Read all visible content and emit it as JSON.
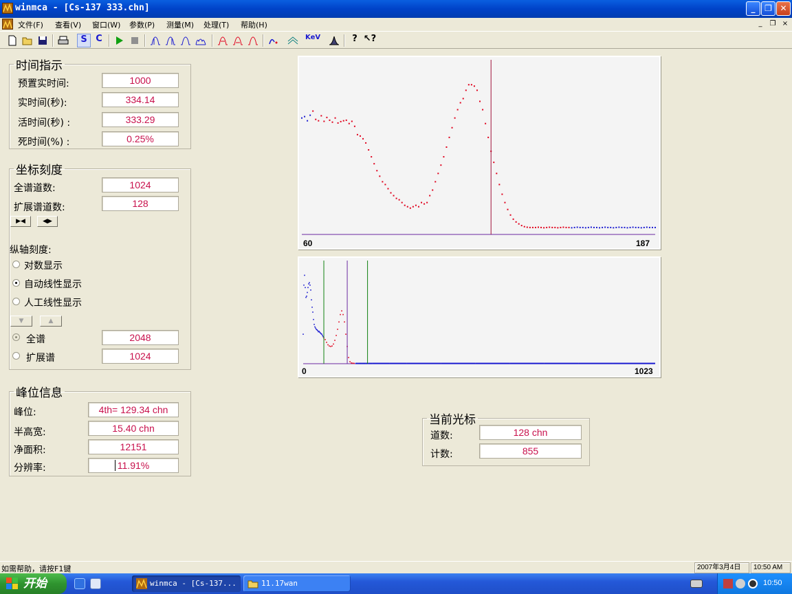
{
  "window": {
    "title": "winmca - [Cs-137 333.chn]",
    "min_label": "_",
    "restore_label": "❐",
    "close_label": "✕"
  },
  "menu": {
    "items": [
      "文件(F)",
      "查看(V)",
      "窗口(W)",
      "参数(P)",
      "测量(M)",
      "处理(T)",
      "帮助(H)"
    ],
    "mdi_min": "_",
    "mdi_restore": "❐",
    "mdi_close": "×"
  },
  "toolbar": {
    "icons": [
      "new-file-icon",
      "open-folder-icon",
      "save-disk-icon",
      "print-icon",
      "s-scale-icon",
      "c-scale-icon",
      "play-icon",
      "stop-icon",
      "peak1-icon",
      "peak2-icon",
      "peak3-icon",
      "peak4-icon",
      "mark1-icon",
      "mark2-icon",
      "mark3-icon",
      "fit-icon",
      "smooth-icon",
      "kev-icon",
      "gauss-icon",
      "help-icon",
      "context-help-icon"
    ],
    "s_label": "S",
    "c_label": "C",
    "kev_label": "KeV"
  },
  "time_panel": {
    "title": "时间指示",
    "rows": [
      {
        "label": "预置实时间:",
        "value": "1000"
      },
      {
        "label": "实时间(秒):",
        "value": "334.14"
      },
      {
        "label": "活时间(秒) :",
        "value": "333.29"
      },
      {
        "label": "死时间(%) :",
        "value": "0.25%"
      }
    ]
  },
  "scale_panel": {
    "title": "坐标刻度",
    "full_channels_label": "全谱道数:",
    "full_channels_value": "1024",
    "ext_channels_label": "扩展谱道数:",
    "ext_channels_value": "128",
    "shrink_btn": "▶◀",
    "expand_btn": "◀▶",
    "yaxis_title": "纵轴刻度:",
    "options": [
      "对数显示",
      "自动线性显示",
      "人工线性显示"
    ],
    "down_btn": "▼",
    "up_btn": "▲",
    "full_label": "全谱",
    "full_value": "2048",
    "ext_label": "扩展谱",
    "ext_value": "1024"
  },
  "peak_panel": {
    "title": "峰位信息",
    "rows": [
      {
        "label": "峰位:",
        "value": "4th= 129.34 chn"
      },
      {
        "label": "半高宽:",
        "value": "15.40 chn"
      },
      {
        "label": "净面积:",
        "value": "12151"
      },
      {
        "label": "分辨率:",
        "value": "11.91%"
      }
    ]
  },
  "cursor_panel": {
    "title": "当前光标",
    "rows": [
      {
        "label": "道数:",
        "value": "128 chn"
      },
      {
        "label": "计数:",
        "value": "855"
      }
    ]
  },
  "chart_data": [
    {
      "type": "scatter",
      "name": "expanded-spectrum",
      "xlim": [
        60,
        187
      ],
      "x_tick_labels": [
        "60",
        "187"
      ],
      "cursor_channel": 128,
      "roi_color": "#e0001c",
      "outside_color": "#1a1ad0",
      "roi": [
        64,
        156
      ],
      "x": [
        60,
        61,
        62,
        63,
        64,
        65,
        66,
        67,
        68,
        69,
        70,
        71,
        72,
        73,
        74,
        75,
        76,
        77,
        78,
        79,
        80,
        81,
        82,
        83,
        84,
        85,
        86,
        87,
        88,
        89,
        90,
        91,
        92,
        93,
        94,
        95,
        96,
        97,
        98,
        99,
        100,
        101,
        102,
        103,
        104,
        105,
        106,
        107,
        108,
        109,
        110,
        111,
        112,
        113,
        114,
        115,
        116,
        117,
        118,
        119,
        120,
        121,
        122,
        123,
        124,
        125,
        126,
        127,
        128,
        129,
        130,
        131,
        132,
        133,
        134,
        135,
        136,
        137,
        138,
        139,
        140,
        141,
        142,
        143,
        144,
        145,
        146,
        147,
        148,
        149,
        150,
        151,
        152,
        153,
        154,
        155,
        156,
        157,
        158,
        159,
        160,
        161,
        162,
        163,
        164,
        165,
        166,
        167,
        168,
        169,
        170,
        171,
        172,
        173,
        174,
        175,
        176,
        177,
        178,
        179,
        180,
        181,
        182,
        183,
        184,
        185,
        186,
        187
      ],
      "y": [
        660,
        665,
        650,
        670,
        685,
        655,
        650,
        668,
        648,
        662,
        652,
        645,
        660,
        642,
        647,
        650,
        652,
        640,
        648,
        630,
        600,
        595,
        585,
        570,
        545,
        520,
        495,
        470,
        450,
        430,
        420,
        405,
        390,
        380,
        370,
        365,
        355,
        345,
        340,
        335,
        340,
        345,
        340,
        355,
        350,
        355,
        380,
        400,
        430,
        460,
        490,
        520,
        555,
        590,
        625,
        660,
        690,
        715,
        730,
        760,
        780,
        780,
        775,
        760,
        720,
        690,
        640,
        590,
        540,
        500,
        460,
        420,
        385,
        355,
        330,
        310,
        295,
        285,
        278,
        272,
        268,
        266,
        265,
        265,
        265,
        266,
        265,
        264,
        265,
        266,
        265,
        265,
        264,
        265,
        266,
        265,
        265,
        264,
        265,
        266,
        265,
        265,
        264,
        265,
        266,
        265,
        265,
        264,
        265,
        266,
        265,
        265,
        264,
        265,
        266,
        265,
        265,
        264,
        265,
        266,
        265,
        265,
        264,
        265,
        266,
        265,
        265,
        265
      ],
      "ylim": [
        240,
        860
      ]
    },
    {
      "type": "line",
      "name": "full-spectrum",
      "xlim": [
        0,
        1023
      ],
      "x_tick_labels": [
        "0",
        "1023"
      ],
      "markers": [
        {
          "channel": 60,
          "color": "#108010"
        },
        {
          "channel": 128,
          "color": "#6a28a0"
        },
        {
          "channel": 187,
          "color": "#108010"
        }
      ],
      "x": [
        0,
        2,
        4,
        6,
        8,
        10,
        12,
        14,
        16,
        18,
        20,
        22,
        24,
        26,
        28,
        30,
        32,
        34,
        36,
        38,
        40,
        42,
        44,
        46,
        48,
        50,
        52,
        54,
        56,
        58,
        60,
        64,
        68,
        72,
        76,
        80,
        84,
        88,
        92,
        96,
        100,
        104,
        108,
        112,
        116,
        120,
        124,
        128,
        132,
        136,
        140,
        144,
        148,
        152,
        156,
        160,
        170,
        180,
        190,
        200,
        250,
        300,
        400,
        500,
        600,
        700,
        800,
        900,
        1023
      ],
      "y": [
        1200,
        3200,
        3600,
        3100,
        2700,
        2750,
        2900,
        3100,
        3250,
        3300,
        3200,
        3000,
        2600,
        2300,
        2100,
        1800,
        1600,
        1500,
        1450,
        1400,
        1380,
        1350,
        1300,
        1320,
        1280,
        1250,
        1220,
        1200,
        1150,
        1100,
        1050,
        980,
        870,
        770,
        720,
        700,
        720,
        800,
        950,
        1150,
        1400,
        1700,
        2000,
        2150,
        2000,
        1700,
        1200,
        700,
        250,
        80,
        30,
        20,
        15,
        12,
        10,
        10,
        10,
        10,
        10,
        10,
        10,
        10,
        10,
        10,
        10,
        10,
        10,
        10,
        10
      ],
      "ylim": [
        0,
        4200
      ]
    }
  ],
  "status": {
    "text": "如需帮助，请按F1键",
    "date": "2007年3月4日",
    "time": "10:50 AM"
  },
  "taskbar": {
    "start_label": "开始",
    "tasks": [
      {
        "label": "winmca - [Cs-137..."
      },
      {
        "label": "11.17wan"
      }
    ],
    "clock": "10:50"
  }
}
